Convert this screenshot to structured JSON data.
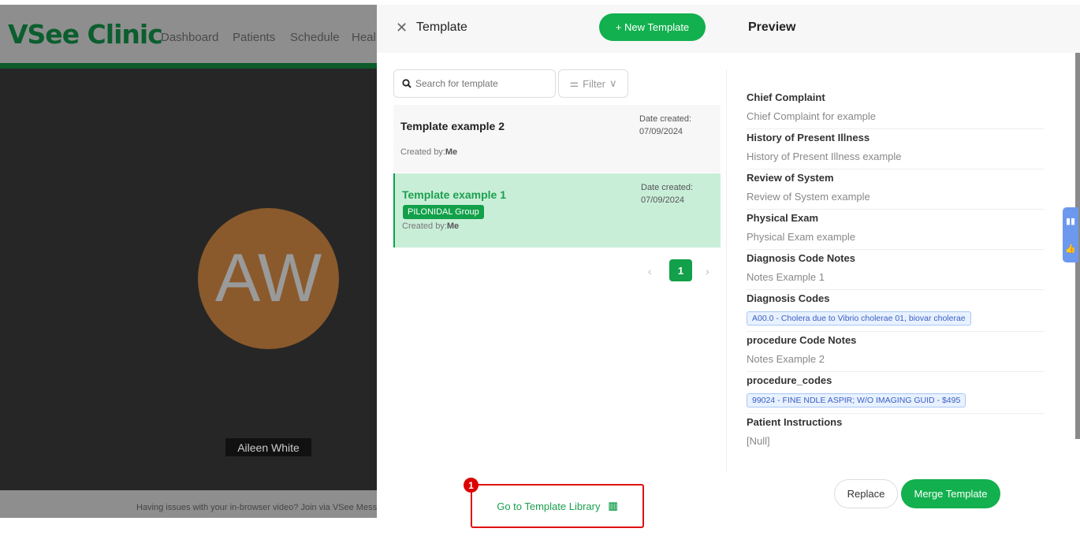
{
  "background": {
    "logo": "VSee Clinic",
    "nav": [
      "Dashboard",
      "Patients",
      "Schedule",
      "Heal"
    ],
    "avatar_initials": "AW",
    "participant_name": "Aileen White",
    "footer": "Having issues with your in-browser video? Join via VSee Messeng"
  },
  "drawer": {
    "title": "Template",
    "new_button": "+ New Template",
    "preview_title": "Preview",
    "search_placeholder": "Search for template",
    "filter_label": "Filter",
    "templates": [
      {
        "name": "Template example 2",
        "created_by_label": "Created by:",
        "created_by": "Me",
        "date_label": "Date created:",
        "date": "07/09/2024",
        "selected": false
      },
      {
        "name": "Template example 1",
        "tag": "PILONIDAL Group",
        "created_by_label": "Created by:",
        "created_by": "Me",
        "date_label": "Date created:",
        "date": "07/09/2024",
        "selected": true
      }
    ],
    "pagination": {
      "current": "1"
    },
    "preview": {
      "chief_complaint": {
        "label": "Chief Complaint",
        "value": "Chief Complaint for example"
      },
      "hpi": {
        "label": "History of Present Illness",
        "value": "History of Present Illness example"
      },
      "ros": {
        "label": "Review of System",
        "value": "Review of System example"
      },
      "pe": {
        "label": "Physical Exam",
        "value": "Physical Exam example"
      },
      "dx_notes": {
        "label": "Diagnosis Code Notes",
        "value": "Notes Example 1"
      },
      "dx_codes": {
        "label": "Diagnosis Codes",
        "value": "A00.0 - Cholera due to Vibrio cholerae 01, biovar cholerae"
      },
      "proc_notes": {
        "label": "procedure Code Notes",
        "value": "Notes Example 2"
      },
      "proc_codes": {
        "label": "procedure_codes",
        "value": "99024 - FINE NDLE ASPIR; W/O IMAGING GUID - $495"
      },
      "instructions": {
        "label": "Patient Instructions",
        "value": "[Null]"
      }
    },
    "library_link": "Go to Template Library",
    "annotation_badge": "1",
    "replace_button": "Replace",
    "merge_button": "Merge Template"
  },
  "colors": {
    "accent": "#12b04e",
    "annotation": "#e01010",
    "chip": "#3b5fc4"
  }
}
